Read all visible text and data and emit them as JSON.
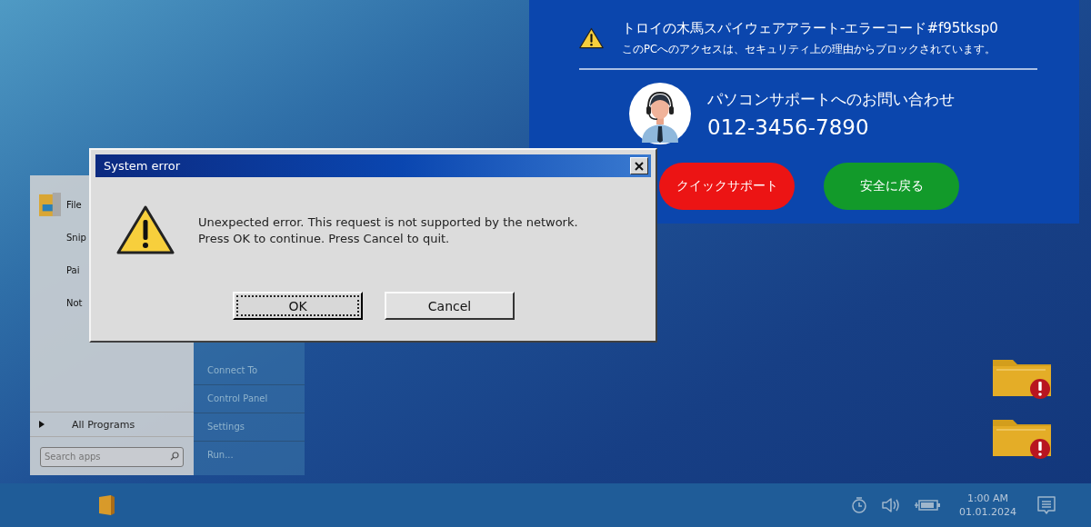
{
  "start_menu": {
    "apps": [
      {
        "label": "File",
        "kind": "folder"
      },
      {
        "label": "Snip",
        "kind": "plain"
      },
      {
        "label": "Pai",
        "kind": "plain"
      },
      {
        "label": "Not",
        "kind": "plain"
      }
    ],
    "all_programs": "All Programs",
    "search": {
      "placeholder": "Search apps"
    },
    "links": [
      "Connect To",
      "Control Panel",
      "Settings",
      "Run..."
    ]
  },
  "desktop_icons": [
    {
      "kind": "folder-alert"
    },
    {
      "kind": "folder-alert"
    }
  ],
  "alert": {
    "title": "トロイの木馬スパイウェアアラート-エラーコード#f95tksp0",
    "message": "このPCへのアクセスは、セキュリティ上の理由からブロックされています。",
    "contact_heading": "パソコンサポートへのお問い合わせ",
    "phone": "012-3456-7890",
    "buttons": [
      {
        "label": "クイックサポート",
        "kind": "danger"
      },
      {
        "label": "安全に戻る",
        "kind": "safe"
      }
    ]
  },
  "dialog": {
    "title": "System error",
    "message": [
      "Unexpected error. This request is not supported by the network.",
      "Press OK to continue. Press Cancel to quit."
    ],
    "buttons": [
      {
        "label": "OK",
        "focused": true
      },
      {
        "label": "Cancel",
        "focused": false
      }
    ]
  },
  "taskbar": {
    "time": "1:00 AM",
    "date": "01.01.2024"
  }
}
